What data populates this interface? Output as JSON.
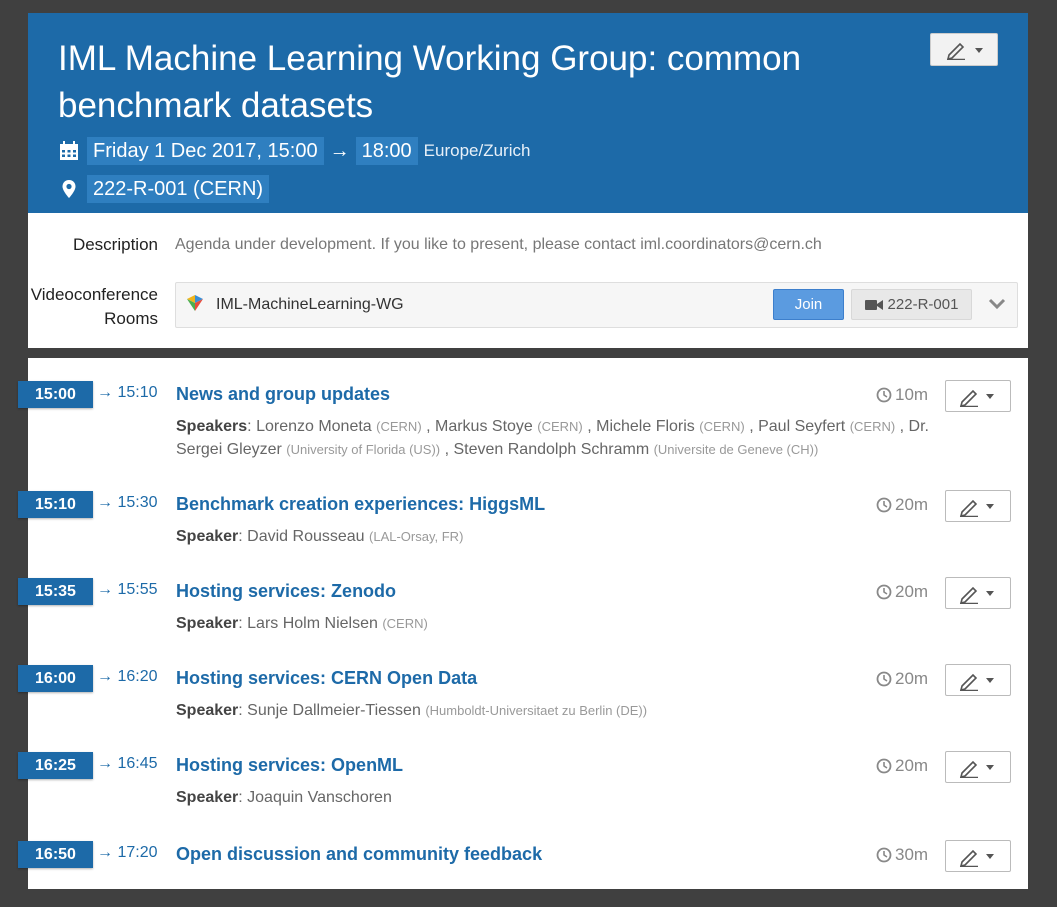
{
  "event": {
    "title": "IML Machine Learning Working Group: common benchmark datasets",
    "date_start": "Friday 1 Dec 2017, 15:00",
    "arrow": "→",
    "time_end": "18:00",
    "timezone": "Europe/Zurich",
    "location": "222-R-001 (CERN)"
  },
  "info": {
    "description_label": "Description",
    "description_text": "Agenda under development. If you like to present, please contact iml.coordinators@cern.ch",
    "vc_label_line1": "Videoconference",
    "vc_label_line2": "Rooms",
    "vc_name": "IML-MachineLearning-WG",
    "join_label": "Join",
    "room_label": "222-R-001"
  },
  "timetable": [
    {
      "start": "15:00",
      "end": "→ 15:10",
      "title": "News and group updates",
      "duration": "10m",
      "speakers_label": "Speakers",
      "speakers": [
        {
          "name": "Lorenzo Moneta",
          "aff": "(CERN)"
        },
        {
          "name": "Markus Stoye",
          "aff": "(CERN)"
        },
        {
          "name": "Michele Floris",
          "aff": "(CERN)"
        },
        {
          "name": "Paul Seyfert",
          "aff": "(CERN)"
        },
        {
          "name": "Dr. Sergei Gleyzer",
          "aff": "(University of Florida (US))"
        },
        {
          "name": "Steven Randolph Schramm",
          "aff": "(Universite de Geneve (CH))"
        }
      ]
    },
    {
      "start": "15:10",
      "end": "→ 15:30",
      "title": "Benchmark creation experiences: HiggsML",
      "duration": "20m",
      "speakers_label": "Speaker",
      "speakers": [
        {
          "name": "David Rousseau",
          "aff": "(LAL-Orsay, FR)"
        }
      ]
    },
    {
      "start": "15:35",
      "end": "→ 15:55",
      "title": "Hosting services: Zenodo",
      "duration": "20m",
      "speakers_label": "Speaker",
      "speakers": [
        {
          "name": "Lars Holm Nielsen",
          "aff": "(CERN)"
        }
      ]
    },
    {
      "start": "16:00",
      "end": "→ 16:20",
      "title": "Hosting services: CERN Open Data",
      "duration": "20m",
      "speakers_label": "Speaker",
      "speakers": [
        {
          "name": "Sunje Dallmeier-Tiessen",
          "aff": "(Humboldt-Universitaet zu Berlin (DE))"
        }
      ]
    },
    {
      "start": "16:25",
      "end": "→ 16:45",
      "title": "Hosting services: OpenML",
      "duration": "20m",
      "speakers_label": "Speaker",
      "speakers": [
        {
          "name": "Joaquin Vanschoren",
          "aff": ""
        }
      ]
    },
    {
      "start": "16:50",
      "end": "→ 17:20",
      "title": "Open discussion and community feedback",
      "duration": "30m",
      "speakers_label": "",
      "speakers": []
    }
  ],
  "colors": {
    "header_bg": "#1d6aa8",
    "highlight_bg": "#2f7fc0",
    "join_btn": "#5b9be0",
    "page_bg": "#404040"
  },
  "icons": {
    "header_date": "calendar-icon",
    "header_location": "map-marker-icon",
    "edit": "pencil-icon",
    "duration": "clock-icon",
    "room": "video-camera-icon",
    "expand": "chevron-down-icon"
  }
}
